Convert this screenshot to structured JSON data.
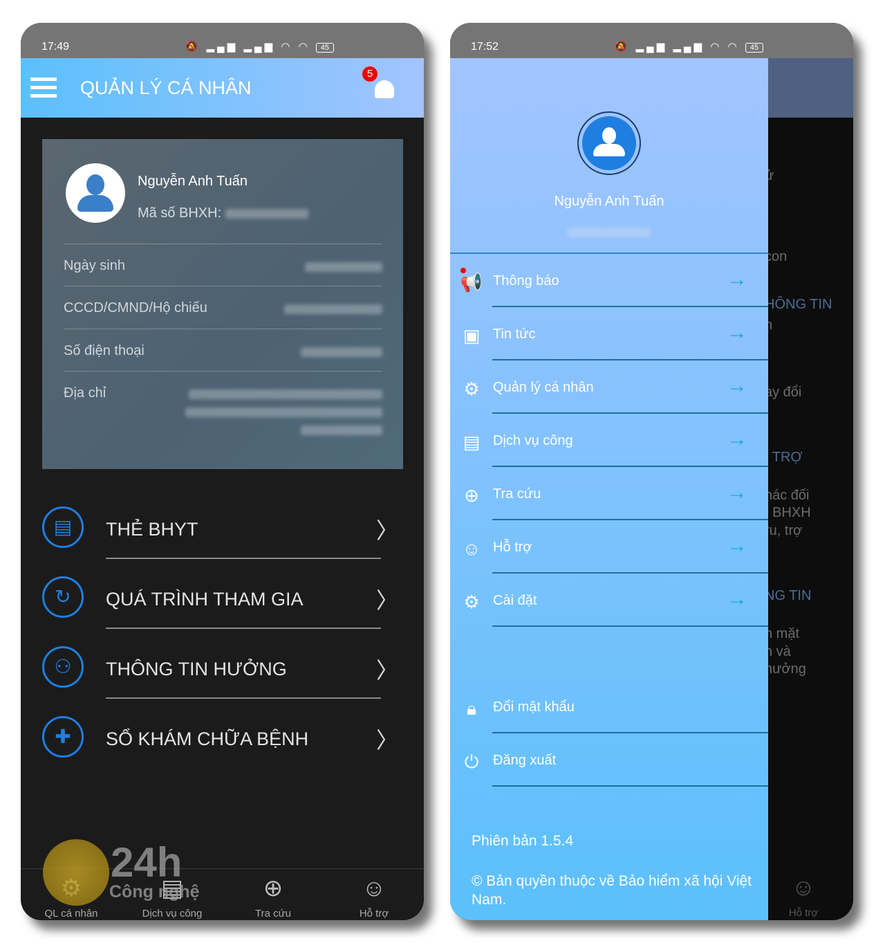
{
  "left": {
    "status": {
      "time": "17:49",
      "battery": "45"
    },
    "header": {
      "title": "QUẢN LÝ CÁ NHÂN",
      "notification_count": "5"
    },
    "profile": {
      "name": "Nguyễn Anh Tuấn",
      "bhxh_label": "Mã số BHXH:",
      "rows": [
        {
          "label": "Ngày sinh"
        },
        {
          "label": "CCCD/CMND/Hộ chiếu"
        },
        {
          "label": "Số điện thoại"
        },
        {
          "label": "Địa chỉ"
        }
      ]
    },
    "menu": [
      {
        "label": "THẺ BHYT",
        "icon": "card-icon"
      },
      {
        "label": "QUÁ TRÌNH THAM GIA",
        "icon": "history-icon"
      },
      {
        "label": "THÔNG TIN HƯỞNG",
        "icon": "user-info-icon"
      },
      {
        "label": "SỔ KHÁM CHỮA BỆNH",
        "icon": "medical-cross-icon"
      }
    ],
    "bottom_nav": [
      {
        "label": "QL cá nhân"
      },
      {
        "label": "Dịch vụ công"
      },
      {
        "label": "Tra cứu"
      },
      {
        "label": "Hỗ trợ"
      }
    ],
    "watermark": {
      "big": "24h",
      "small": "Công nghệ"
    }
  },
  "right": {
    "status": {
      "time": "17:52",
      "battery": "45"
    },
    "drawer": {
      "name": "Nguyễn Anh Tuấn",
      "items": [
        {
          "label": "Thông báo",
          "icon": "megaphone-icon",
          "unread": true
        },
        {
          "label": "Tin tức",
          "icon": "news-icon"
        },
        {
          "label": "Quản lý cá nhân",
          "icon": "user-gear-icon"
        },
        {
          "label": "Dịch vụ công",
          "icon": "clipboard-icon"
        },
        {
          "label": "Tra cứu",
          "icon": "globe-search-icon"
        },
        {
          "label": "Hỗ trợ",
          "icon": "support-icon"
        },
        {
          "label": "Cài đặt",
          "icon": "settings-icon"
        }
      ],
      "account": [
        {
          "label": "Đổi mật khẩu",
          "icon": "lock-icon"
        },
        {
          "label": "Đăng xuất",
          "icon": "power-icon"
        }
      ],
      "version": "Phiên bản 1.5.4",
      "copyright": "© Bản quyền thuộc về  Bảo hiểm xã hội Việt Nam."
    },
    "background_fragments": [
      "ử",
      "con",
      "HÔNG TIN",
      "n",
      "ay đổi",
      ". TRỢ",
      "hác đối",
      ". BHXH",
      "ru, trợ",
      "NG TIN",
      "n mặt",
      "n và",
      "hưởng"
    ],
    "bottom_nav_visible": "Hỗ trợ"
  },
  "colors": {
    "header_start": "#5bc0fb",
    "header_end": "#a3c4ff",
    "accent": "#1e7fe0",
    "arrow": "#1aa7e6",
    "badge": "#ee0000"
  }
}
